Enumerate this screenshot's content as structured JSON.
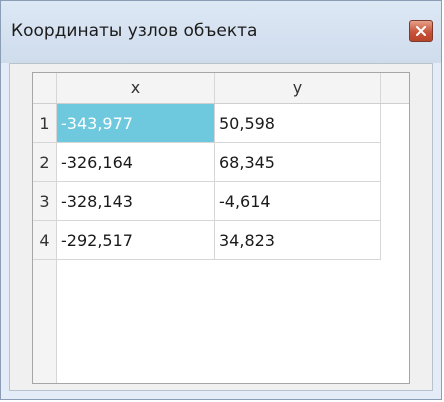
{
  "window": {
    "title": "Координаты узлов объекта",
    "close_icon": "close-icon"
  },
  "table": {
    "columns": [
      "x",
      "y"
    ],
    "rows": [
      {
        "num": "1",
        "x": "-343,977",
        "y": "50,598",
        "selected": true
      },
      {
        "num": "2",
        "x": "-326,164",
        "y": "68,345"
      },
      {
        "num": "3",
        "x": "-328,143",
        "y": "-4,614"
      },
      {
        "num": "4",
        "x": "-292,517",
        "y": "34,823"
      }
    ]
  },
  "colors": {
    "selection": "#6fc9de",
    "close_button": "#c7533a"
  }
}
